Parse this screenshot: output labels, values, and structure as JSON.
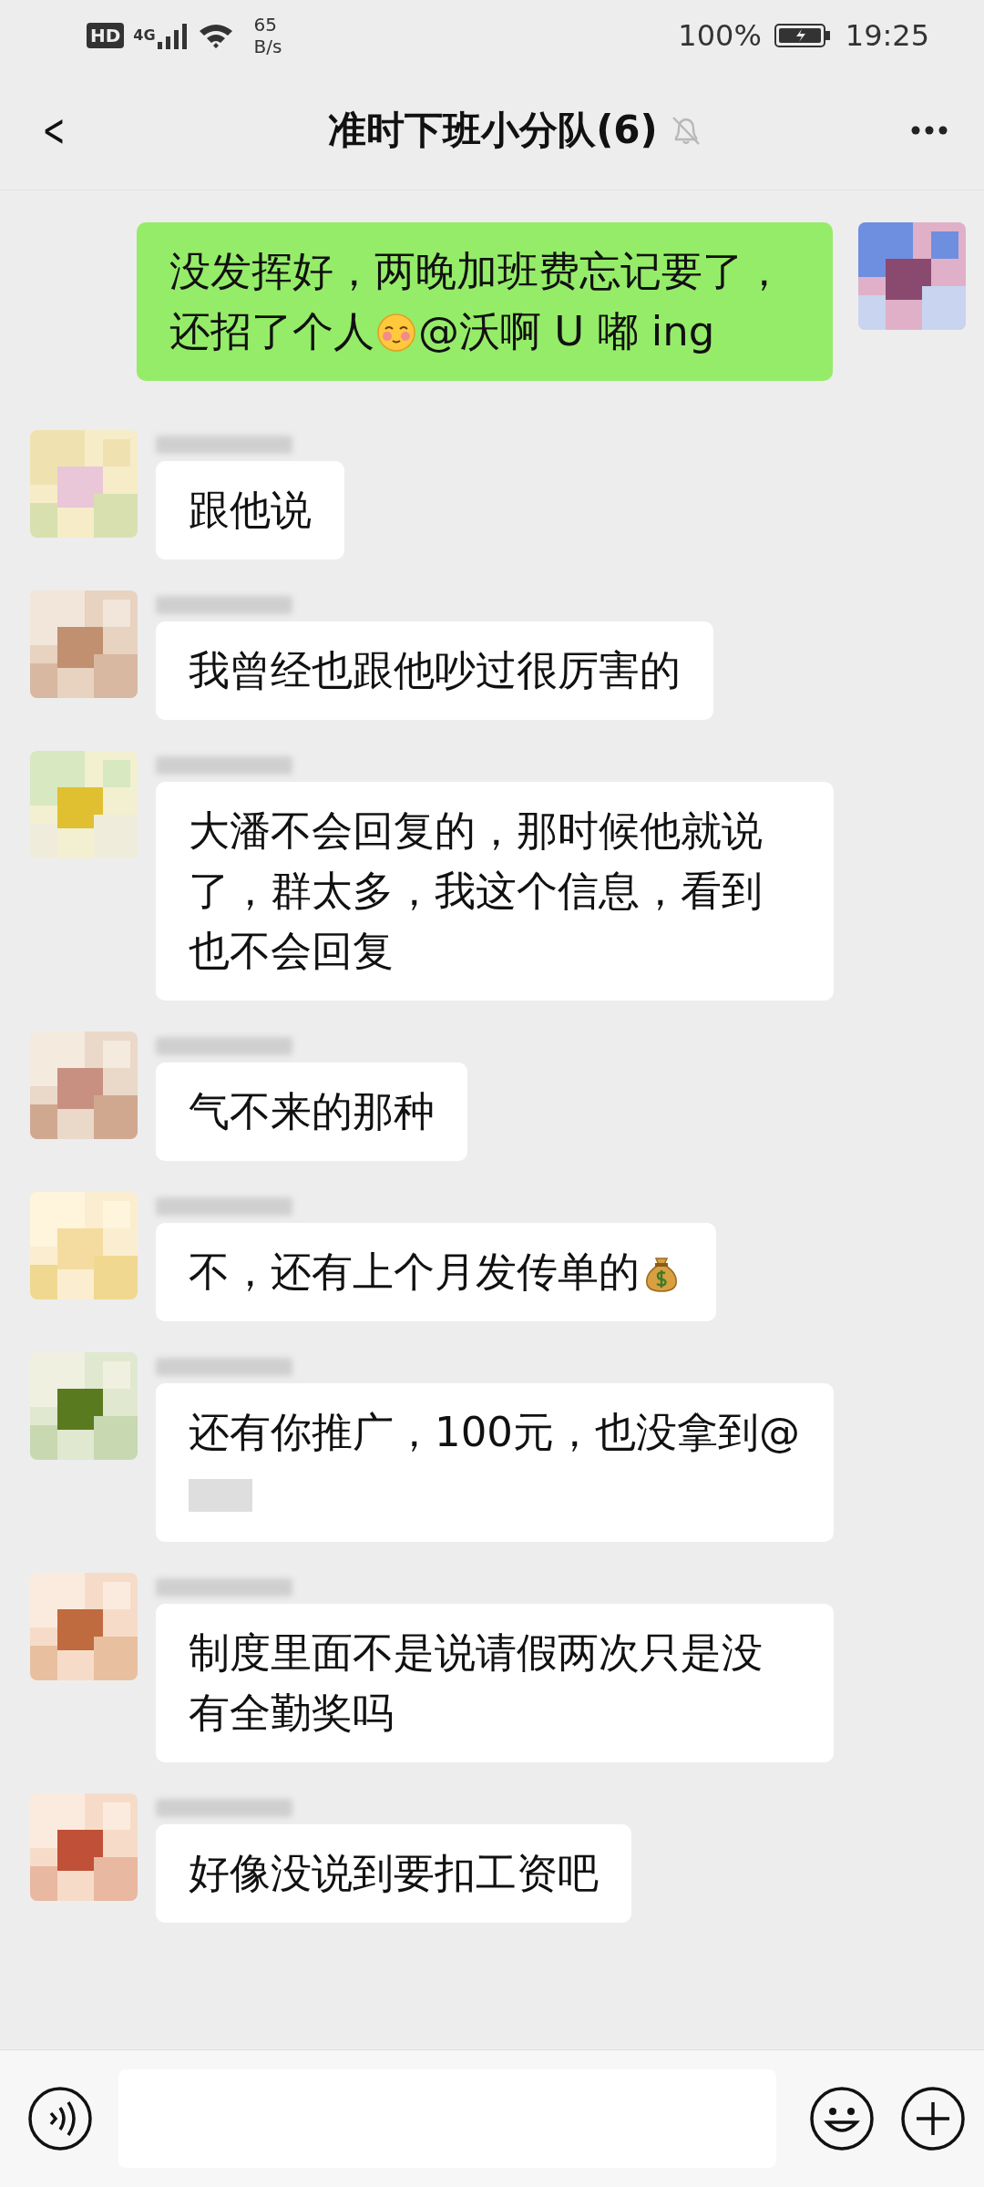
{
  "status_bar": {
    "hd": "HD",
    "network": "4G",
    "speed_value": "65",
    "speed_unit": "B/s",
    "battery": "100%",
    "time": "19:25"
  },
  "header": {
    "back": "<",
    "title": "准时下班小分队(6)",
    "muted": true
  },
  "messages": [
    {
      "from_self": true,
      "segments": [
        {
          "kind": "text",
          "text": "没发挥好，两晚加班费忘记要了，还招了个人"
        },
        {
          "kind": "blush"
        },
        {
          "kind": "text",
          "text": "@沃啊 U 嘟 ing"
        }
      ]
    },
    {
      "from_self": false,
      "segments": [
        {
          "kind": "text",
          "text": "跟他说"
        }
      ]
    },
    {
      "from_self": false,
      "segments": [
        {
          "kind": "text",
          "text": "我曾经也跟他吵过很厉害的"
        }
      ]
    },
    {
      "from_self": false,
      "segments": [
        {
          "kind": "text",
          "text": "大潘不会回复的，那时候他就说了，群太多，我这个信息，看到也不会回复"
        }
      ]
    },
    {
      "from_self": false,
      "segments": [
        {
          "kind": "text",
          "text": "气不来的那种"
        }
      ]
    },
    {
      "from_self": false,
      "segments": [
        {
          "kind": "text",
          "text": "不，还有上个月发传单的"
        },
        {
          "kind": "money-bag"
        }
      ]
    },
    {
      "from_self": false,
      "segments": [
        {
          "kind": "text",
          "text": "还有你推广，100元，也没拿到@"
        },
        {
          "kind": "redacted"
        }
      ]
    },
    {
      "from_self": false,
      "segments": [
        {
          "kind": "text",
          "text": "制度里面不是说请假两次只是没有全勤奖吗"
        }
      ]
    },
    {
      "from_self": false,
      "segments": [
        {
          "kind": "text",
          "text": "好像没说到要扣工资吧"
        }
      ]
    }
  ]
}
